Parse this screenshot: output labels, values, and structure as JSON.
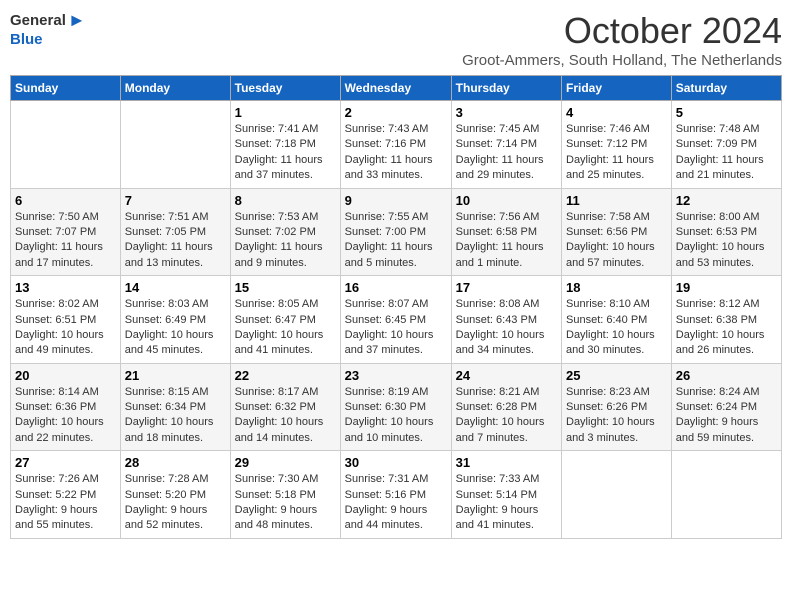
{
  "logo": {
    "general": "General",
    "blue": "Blue",
    "arrow": "▶"
  },
  "title": "October 2024",
  "location": "Groot-Ammers, South Holland, The Netherlands",
  "weekdays": [
    "Sunday",
    "Monday",
    "Tuesday",
    "Wednesday",
    "Thursday",
    "Friday",
    "Saturday"
  ],
  "weeks": [
    [
      {
        "day": "",
        "info": ""
      },
      {
        "day": "",
        "info": ""
      },
      {
        "day": "1",
        "info": "Sunrise: 7:41 AM\nSunset: 7:18 PM\nDaylight: 11 hours and 37 minutes."
      },
      {
        "day": "2",
        "info": "Sunrise: 7:43 AM\nSunset: 7:16 PM\nDaylight: 11 hours and 33 minutes."
      },
      {
        "day": "3",
        "info": "Sunrise: 7:45 AM\nSunset: 7:14 PM\nDaylight: 11 hours and 29 minutes."
      },
      {
        "day": "4",
        "info": "Sunrise: 7:46 AM\nSunset: 7:12 PM\nDaylight: 11 hours and 25 minutes."
      },
      {
        "day": "5",
        "info": "Sunrise: 7:48 AM\nSunset: 7:09 PM\nDaylight: 11 hours and 21 minutes."
      }
    ],
    [
      {
        "day": "6",
        "info": "Sunrise: 7:50 AM\nSunset: 7:07 PM\nDaylight: 11 hours and 17 minutes."
      },
      {
        "day": "7",
        "info": "Sunrise: 7:51 AM\nSunset: 7:05 PM\nDaylight: 11 hours and 13 minutes."
      },
      {
        "day": "8",
        "info": "Sunrise: 7:53 AM\nSunset: 7:02 PM\nDaylight: 11 hours and 9 minutes."
      },
      {
        "day": "9",
        "info": "Sunrise: 7:55 AM\nSunset: 7:00 PM\nDaylight: 11 hours and 5 minutes."
      },
      {
        "day": "10",
        "info": "Sunrise: 7:56 AM\nSunset: 6:58 PM\nDaylight: 11 hours and 1 minute."
      },
      {
        "day": "11",
        "info": "Sunrise: 7:58 AM\nSunset: 6:56 PM\nDaylight: 10 hours and 57 minutes."
      },
      {
        "day": "12",
        "info": "Sunrise: 8:00 AM\nSunset: 6:53 PM\nDaylight: 10 hours and 53 minutes."
      }
    ],
    [
      {
        "day": "13",
        "info": "Sunrise: 8:02 AM\nSunset: 6:51 PM\nDaylight: 10 hours and 49 minutes."
      },
      {
        "day": "14",
        "info": "Sunrise: 8:03 AM\nSunset: 6:49 PM\nDaylight: 10 hours and 45 minutes."
      },
      {
        "day": "15",
        "info": "Sunrise: 8:05 AM\nSunset: 6:47 PM\nDaylight: 10 hours and 41 minutes."
      },
      {
        "day": "16",
        "info": "Sunrise: 8:07 AM\nSunset: 6:45 PM\nDaylight: 10 hours and 37 minutes."
      },
      {
        "day": "17",
        "info": "Sunrise: 8:08 AM\nSunset: 6:43 PM\nDaylight: 10 hours and 34 minutes."
      },
      {
        "day": "18",
        "info": "Sunrise: 8:10 AM\nSunset: 6:40 PM\nDaylight: 10 hours and 30 minutes."
      },
      {
        "day": "19",
        "info": "Sunrise: 8:12 AM\nSunset: 6:38 PM\nDaylight: 10 hours and 26 minutes."
      }
    ],
    [
      {
        "day": "20",
        "info": "Sunrise: 8:14 AM\nSunset: 6:36 PM\nDaylight: 10 hours and 22 minutes."
      },
      {
        "day": "21",
        "info": "Sunrise: 8:15 AM\nSunset: 6:34 PM\nDaylight: 10 hours and 18 minutes."
      },
      {
        "day": "22",
        "info": "Sunrise: 8:17 AM\nSunset: 6:32 PM\nDaylight: 10 hours and 14 minutes."
      },
      {
        "day": "23",
        "info": "Sunrise: 8:19 AM\nSunset: 6:30 PM\nDaylight: 10 hours and 10 minutes."
      },
      {
        "day": "24",
        "info": "Sunrise: 8:21 AM\nSunset: 6:28 PM\nDaylight: 10 hours and 7 minutes."
      },
      {
        "day": "25",
        "info": "Sunrise: 8:23 AM\nSunset: 6:26 PM\nDaylight: 10 hours and 3 minutes."
      },
      {
        "day": "26",
        "info": "Sunrise: 8:24 AM\nSunset: 6:24 PM\nDaylight: 9 hours and 59 minutes."
      }
    ],
    [
      {
        "day": "27",
        "info": "Sunrise: 7:26 AM\nSunset: 5:22 PM\nDaylight: 9 hours and 55 minutes."
      },
      {
        "day": "28",
        "info": "Sunrise: 7:28 AM\nSunset: 5:20 PM\nDaylight: 9 hours and 52 minutes."
      },
      {
        "day": "29",
        "info": "Sunrise: 7:30 AM\nSunset: 5:18 PM\nDaylight: 9 hours and 48 minutes."
      },
      {
        "day": "30",
        "info": "Sunrise: 7:31 AM\nSunset: 5:16 PM\nDaylight: 9 hours and 44 minutes."
      },
      {
        "day": "31",
        "info": "Sunrise: 7:33 AM\nSunset: 5:14 PM\nDaylight: 9 hours and 41 minutes."
      },
      {
        "day": "",
        "info": ""
      },
      {
        "day": "",
        "info": ""
      }
    ]
  ]
}
